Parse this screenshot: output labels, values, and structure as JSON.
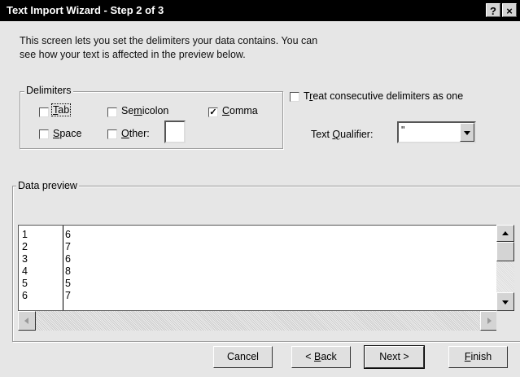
{
  "window": {
    "title": "Text Import Wizard - Step 2 of 3",
    "help_button": "?",
    "close_button": "×"
  },
  "intro": {
    "line1": "This screen lets you set the delimiters your data contains.  You can",
    "line2": "see how your text is affected in the preview below."
  },
  "delimiters": {
    "legend": "Delimiters",
    "tab": {
      "pre": "",
      "u": "T",
      "post": "ab",
      "checked": false
    },
    "semicolon": {
      "pre": "Se",
      "u": "m",
      "post": "icolon",
      "checked": false
    },
    "comma": {
      "pre": "",
      "u": "C",
      "post": "omma",
      "checked": true
    },
    "space": {
      "pre": "",
      "u": "S",
      "post": "pace",
      "checked": false
    },
    "other": {
      "pre": "",
      "u": "O",
      "post": "ther:",
      "checked": false,
      "value": ""
    }
  },
  "options": {
    "consecutive": {
      "pre": "T",
      "u": "r",
      "post": "eat consecutive delimiters as one",
      "checked": false
    },
    "qualifier_label_pre": "Text ",
    "qualifier_label_u": "Q",
    "qualifier_label_post": "ualifier:",
    "qualifier_value": "\""
  },
  "preview": {
    "legend": "Data preview",
    "col1": [
      "1",
      "2",
      "3",
      "4",
      "5",
      "6"
    ],
    "col2": [
      "6",
      "7",
      "6",
      "8",
      "5",
      "7"
    ]
  },
  "buttons": {
    "cancel": "Cancel",
    "back_pre": "< ",
    "back_u": "B",
    "back_post": "ack",
    "next": "Next >",
    "finish_u": "F",
    "finish_post": "inish"
  },
  "colors": {
    "titlebar": "#000000",
    "dialog_bg": "#e6e6e6"
  }
}
